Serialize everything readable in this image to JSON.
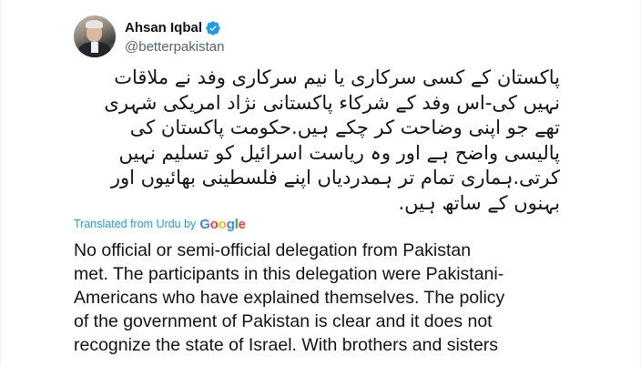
{
  "tweet": {
    "author": {
      "display_name": "Ahsan Iqbal",
      "handle": "@betterpakistan",
      "verified_icon": "verified-badge-icon"
    },
    "urdu_lines": [
      "پاکستان کے کسی سرکاری یا نیم سرکاری وفد نے ملاقات",
      "نہیں کی-اس وفد کے شرکاء پاکستانی نژاد امریکی شہری",
      "تھے جو اپنی وضاحت کر چکے ہیں.حکومت پاکستان کی",
      "پالیسی واضح ہے اور وہ ریاست اسرائیل کو تسلیم نہیں",
      "کرتی.ہماری تمام تر ہمدردیاں اپنے فلسطینی بھائیوں اور",
      "بہنوں کے ساتھ ہیں."
    ],
    "translation": {
      "prefix": "Translated from Urdu by",
      "provider": "Google"
    },
    "english_lines": [
      "No official or semi-official delegation from Pakistan",
      "met. The participants in this delegation were Pakistani-",
      "Americans who have explained themselves. The policy",
      "of the government of Pakistan is clear and it does not",
      "recognize the state of Israel. With brothers and sisters"
    ]
  },
  "colors": {
    "text_primary": "#0f1419",
    "text_secondary": "#536471",
    "accent": "#1d9bf0",
    "verified": "#1d9bf0"
  }
}
